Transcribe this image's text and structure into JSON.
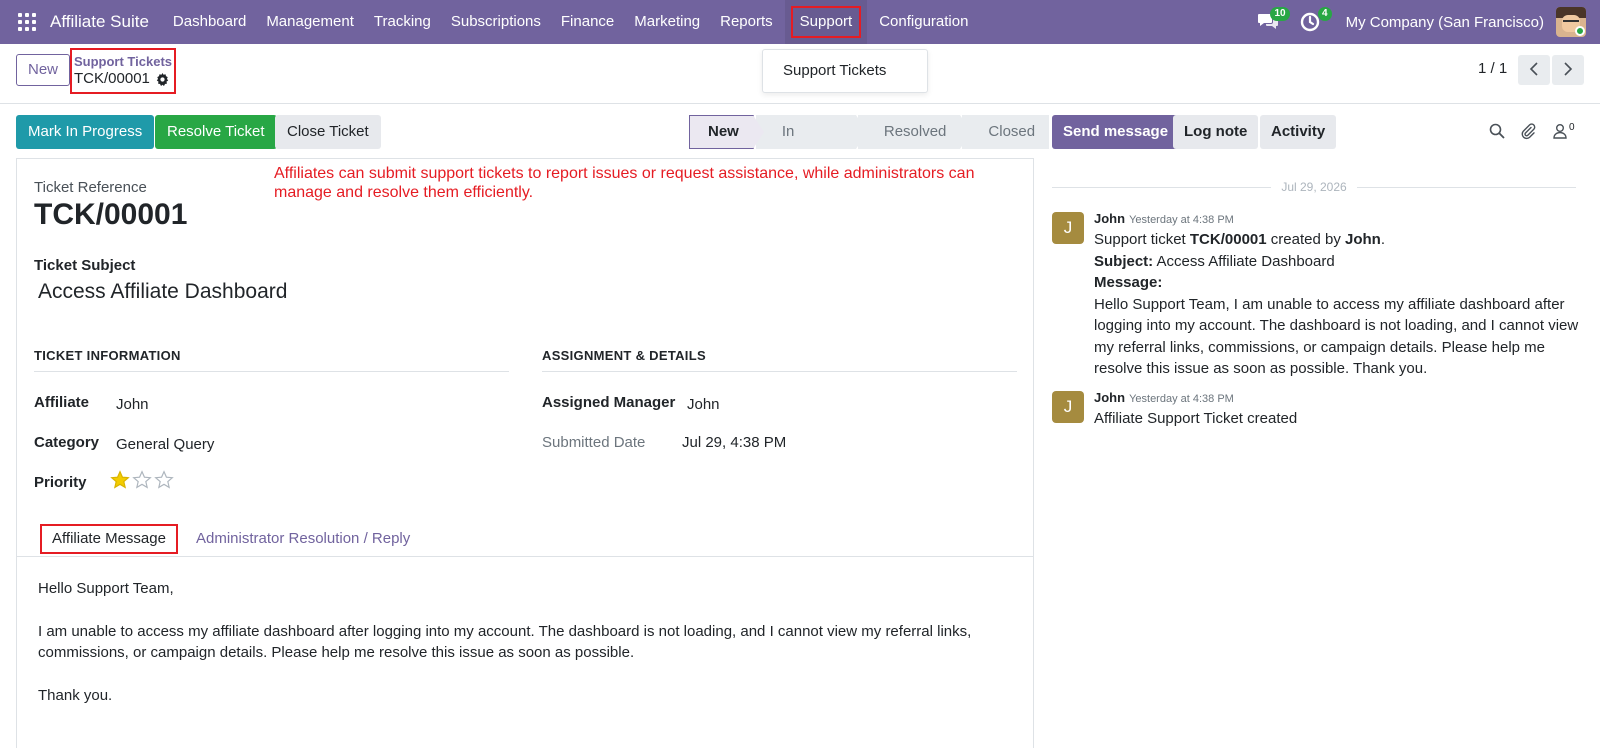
{
  "navbar": {
    "brand": "Affiliate Suite",
    "menu": [
      "Dashboard",
      "Management",
      "Tracking",
      "Subscriptions",
      "Finance",
      "Marketing",
      "Reports",
      "Support",
      "Configuration"
    ],
    "active_menu": "Support",
    "messages_count": "10",
    "activities_count": "4",
    "company": "My Company (San Francisco)"
  },
  "control_panel": {
    "new_label": "New",
    "breadcrumb_parent": "Support Tickets",
    "breadcrumb_current": "TCK/00001",
    "dropdown_item": "Support Tickets",
    "pager": "1 / 1"
  },
  "statusbar": {
    "buttons": [
      "Mark In Progress",
      "Resolve Ticket",
      "Close Ticket"
    ],
    "stages": [
      "New",
      "In Progress",
      "Resolved",
      "Closed"
    ],
    "current_stage": "New"
  },
  "form": {
    "annotation": "Affiliates can submit support tickets to report issues or request assistance, while administrators can manage and resolve them efficiently.",
    "ref_label": "Ticket Reference",
    "ref_value": "TCK/00001",
    "subject_label": "Ticket Subject",
    "subject_value": "Access Affiliate Dashboard",
    "section_info": "TICKET INFORMATION",
    "section_assign": "ASSIGNMENT & DETAILS",
    "affiliate_label": "Affiliate",
    "affiliate_value": "John",
    "category_label": "Category",
    "category_value": "General Query",
    "priority_label": "Priority",
    "priority_value": 1,
    "priority_max": 3,
    "manager_label": "Assigned Manager",
    "manager_value": "John",
    "date_label": "Submitted Date",
    "date_value": "Jul 29, 4:38 PM",
    "tabs": [
      "Affiliate Message",
      "Administrator Resolution / Reply"
    ],
    "message_paragraphs": [
      "Hello Support Team,",
      "I am unable to access my affiliate dashboard after logging into my account. The dashboard is not loading, and I cannot view my referral links, commissions, or campaign details. Please help me resolve this issue as soon as possible.",
      "Thank you."
    ]
  },
  "chatter": {
    "send_label": "Send message",
    "log_label": "Log note",
    "activity_label": "Activity",
    "followers_count": "0",
    "date_separator": "Jul 29, 2026",
    "messages": [
      {
        "initial": "J",
        "author": "John",
        "time": "Yesterday at 4:38 PM",
        "line1_pre": "Support ticket ",
        "line1_ref": "TCK/00001",
        "line1_mid": " created by ",
        "line1_author": "John",
        "line1_end": ".",
        "subject_label": "Subject:",
        "subject_value": " Access Affiliate Dashboard",
        "message_label": "Message:",
        "message_text": "Hello Support Team, I am unable to access my affiliate dashboard after logging into my account. The dashboard is not loading, and I cannot view my referral links, commissions, or campaign details. Please help me resolve this issue as soon as possible. Thank you."
      },
      {
        "initial": "J",
        "author": "John",
        "time": "Yesterday at 4:38 PM",
        "text": "Affiliate Support Ticket created"
      }
    ]
  },
  "colors": {
    "brand": "#71639e",
    "highlight": "#e51c23",
    "teal": "#1f9aa9",
    "green": "#28a745",
    "star": "#f3cc00"
  },
  "icons": [
    "apps-grid-icon",
    "chat-bubbles-icon",
    "clock-activity-icon",
    "gear-icon",
    "chevron-left-icon",
    "chevron-right-icon",
    "search-icon",
    "paperclip-icon",
    "followers-icon",
    "star-icon"
  ]
}
